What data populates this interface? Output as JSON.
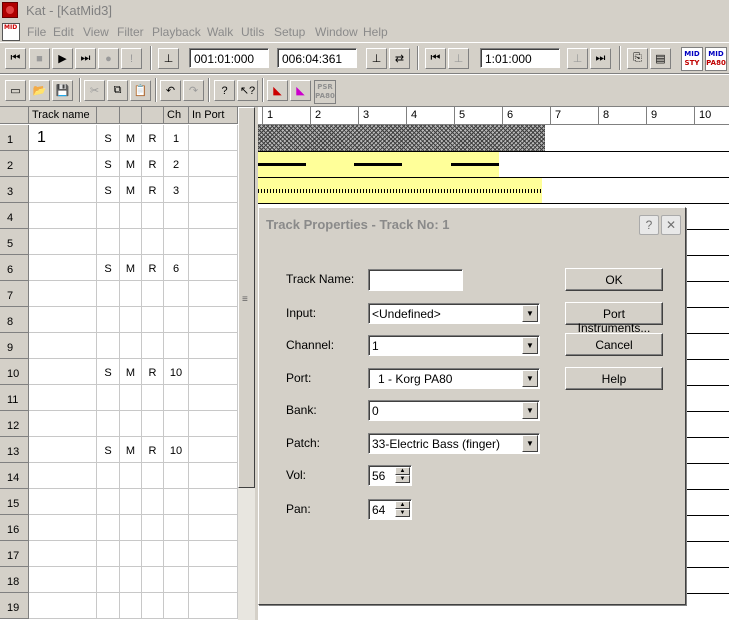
{
  "window": {
    "title": "Kat - [KatMid3]"
  },
  "menu": [
    "File",
    "Edit",
    "View",
    "Filter",
    "Playback",
    "Walk",
    "Utils",
    "Setup",
    "Window",
    "Help"
  ],
  "doc_icon_text": "MID",
  "transport": {
    "position": "001:01:000",
    "length": "006:04:361",
    "loop": "1:01:000"
  },
  "brand_buttons": [
    {
      "top": "MID",
      "bottom": "STY"
    },
    {
      "top": "MID",
      "bottom": "PA80"
    },
    {
      "top": "PSR",
      "bottom": "PA80"
    }
  ],
  "grid": {
    "headers": {
      "track_name": "Track name",
      "ch": "Ch",
      "in_port": "In Port"
    },
    "rows": [
      {
        "num": "1",
        "name": "1",
        "s": "S",
        "m": "M",
        "r": "R",
        "ch": "1"
      },
      {
        "num": "2",
        "name": "",
        "s": "S",
        "m": "M",
        "r": "R",
        "ch": "2"
      },
      {
        "num": "3",
        "name": "",
        "s": "S",
        "m": "M",
        "r": "R",
        "ch": "3"
      },
      {
        "num": "4",
        "name": "",
        "s": "",
        "m": "",
        "r": "",
        "ch": ""
      },
      {
        "num": "5",
        "name": "",
        "s": "",
        "m": "",
        "r": "",
        "ch": ""
      },
      {
        "num": "6",
        "name": "",
        "s": "S",
        "m": "M",
        "r": "R",
        "ch": "6"
      },
      {
        "num": "7",
        "name": "",
        "s": "",
        "m": "",
        "r": "",
        "ch": ""
      },
      {
        "num": "8",
        "name": "",
        "s": "",
        "m": "",
        "r": "",
        "ch": ""
      },
      {
        "num": "9",
        "name": "",
        "s": "",
        "m": "",
        "r": "",
        "ch": ""
      },
      {
        "num": "10",
        "name": "",
        "s": "S",
        "m": "M",
        "r": "R",
        "ch": "10"
      },
      {
        "num": "11",
        "name": "",
        "s": "",
        "m": "",
        "r": "",
        "ch": ""
      },
      {
        "num": "12",
        "name": "",
        "s": "",
        "m": "",
        "r": "",
        "ch": ""
      },
      {
        "num": "13",
        "name": "",
        "s": "S",
        "m": "M",
        "r": "R",
        "ch": "10"
      },
      {
        "num": "14",
        "name": "",
        "s": "",
        "m": "",
        "r": "",
        "ch": ""
      },
      {
        "num": "15",
        "name": "",
        "s": "",
        "m": "",
        "r": "",
        "ch": ""
      },
      {
        "num": "16",
        "name": "",
        "s": "",
        "m": "",
        "r": "",
        "ch": ""
      },
      {
        "num": "17",
        "name": "",
        "s": "",
        "m": "",
        "r": "",
        "ch": ""
      },
      {
        "num": "18",
        "name": "",
        "s": "",
        "m": "",
        "r": "",
        "ch": ""
      },
      {
        "num": "19",
        "name": "",
        "s": "",
        "m": "",
        "r": "",
        "ch": ""
      }
    ]
  },
  "ruler": [
    "1",
    "2",
    "3",
    "4",
    "5",
    "6",
    "7",
    "8",
    "9",
    "10"
  ],
  "dialog": {
    "title": "Track Properties - Track No: 1",
    "help_glyph": "?",
    "close_glyph": "✕",
    "fields": {
      "track_name": {
        "label": "Track Name:",
        "value": ""
      },
      "input": {
        "label": "Input:",
        "value": "<Undefined>"
      },
      "channel": {
        "label": "Channel:",
        "value": "1"
      },
      "port": {
        "label": "Port:",
        "value": "1 - Korg PA80"
      },
      "bank": {
        "label": "Bank:",
        "value": "0"
      },
      "patch": {
        "label": "Patch:",
        "value": "33-Electric Bass (finger)"
      },
      "vol": {
        "label": "Vol:",
        "value": "56"
      },
      "pan": {
        "label": "Pan:",
        "value": "64"
      }
    },
    "buttons": {
      "ok": "OK",
      "port_instruments": "Port Instruments...",
      "cancel": "Cancel",
      "help": "Help"
    }
  }
}
